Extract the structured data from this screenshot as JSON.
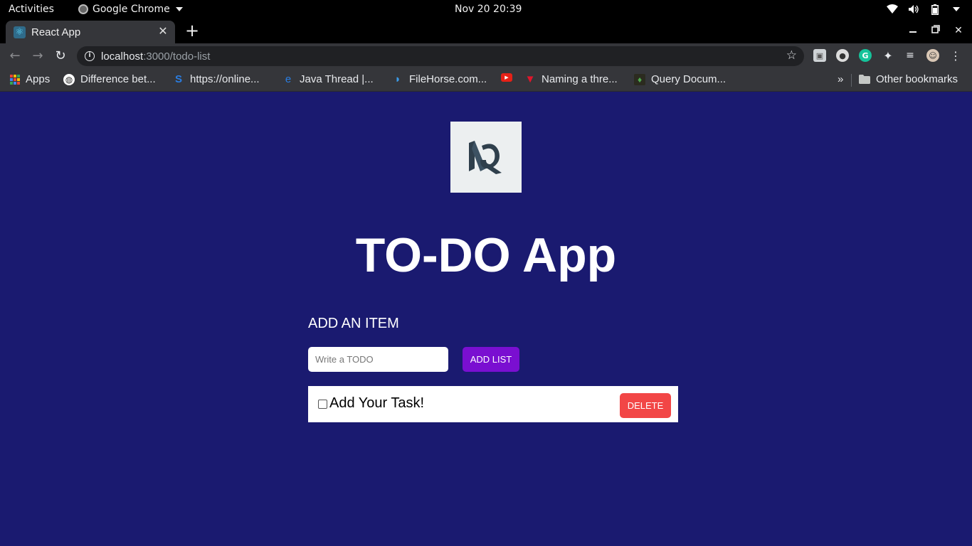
{
  "system_bar": {
    "activities": "Activities",
    "app_name": "Google Chrome",
    "clock": "Nov 20  20:39"
  },
  "browser": {
    "tab_title": "React App",
    "url_host": "localhost",
    "url_path": ":3000/todo-list",
    "bookmarks": [
      {
        "label": "Apps",
        "icon": "apps-grid-icon"
      },
      {
        "label": "Difference bet...",
        "icon": "globe-icon"
      },
      {
        "label": "https://online...",
        "icon": "s-icon"
      },
      {
        "label": "Java Thread |...",
        "icon": "e-icon"
      },
      {
        "label": "FileHorse.com...",
        "icon": "filehorse-icon"
      },
      {
        "label": "",
        "icon": "youtube-icon"
      },
      {
        "label": "Naming a thre...",
        "icon": "v-icon"
      },
      {
        "label": "Query Docum...",
        "icon": "mongodb-leaf-icon"
      }
    ],
    "more_bookmarks": "»",
    "other_bookmarks": "Other bookmarks"
  },
  "app": {
    "title": "TO-DO App",
    "add_label": "ADD AN ITEM",
    "input_placeholder": "Write a TODO",
    "input_value": "",
    "add_button": "ADD LIST",
    "tasks": [
      {
        "text": "Add Your Task!",
        "checked": false,
        "delete_label": "DELETE"
      }
    ]
  },
  "colors": {
    "page_bg": "#1a1a70",
    "add_button": "#7a0fd1",
    "delete_button": "#f24646",
    "logo_bg": "#eceff0",
    "logo_mark": "#2f3f4c"
  }
}
